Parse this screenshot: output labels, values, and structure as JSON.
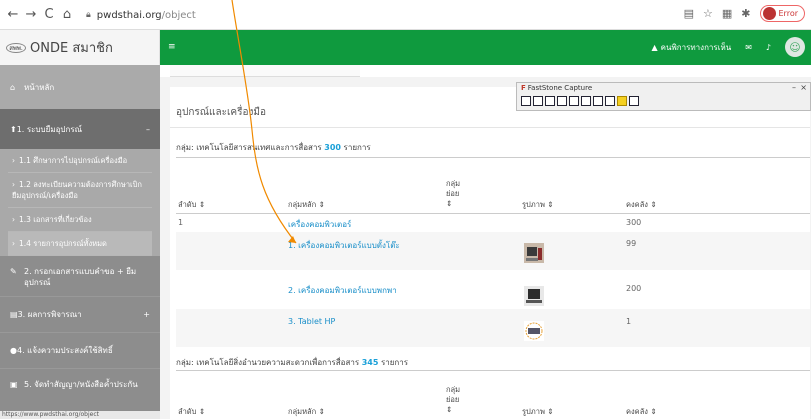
{
  "browser": {
    "url_domain": "pwdsthai.org",
    "url_path": "/object",
    "profile_label": "Error"
  },
  "brand": {
    "logo_text": "สพพ.",
    "title": "ONDE สมาชิก"
  },
  "header": {
    "menu_icon": "≡",
    "user_name": "คนพิการทางการเห็น"
  },
  "sidebar": {
    "home": "หน้าหลัก",
    "menu1": "1. ระบบยืมอุปกรณ์",
    "menu1_sub": [
      "1.1 ศึกษาการไปอุปกรณ์เครื่องมือ",
      "1.2 ลงทะเบียนความต้องการศึกษาเบิกยืมอุปกรณ์/เครื่องมือ",
      "1.3 เอกสารที่เกี่ยวข้อง",
      "1.4 รายการอุปกรณ์ทั้งหมด"
    ],
    "menu2": "2. กรอกเอกสารแบบคำขอ + ยืมอุปกรณ์",
    "menu3": "3. ผลการพิจารณา",
    "menu4": "4. แจ้งความประสงค์ใช้สิทธิ์",
    "menu5": "5. จัดทำสัญญา/หนังสือค้ำประกัน"
  },
  "status_bar_url": "https://www.pwdsthai.org/object",
  "content": {
    "page_title": "อุปกรณ์และเครื่องมือ",
    "group1": {
      "prefix": "กลุ่ม: เทคโนโลยีสารสนเทศและการสื่อสาร",
      "count": "300",
      "suffix": "รายการ"
    },
    "group2": {
      "prefix": "กลุ่ม: เทคโนโลยีสิ่งอำนวยความสะดวกเพื่อการสื่อสาร",
      "count": "345",
      "suffix": "รายการ"
    },
    "headers": {
      "order": "ลำดับ ⇕",
      "main_group": "กลุ่มหลัก ⇕",
      "sub_group_line1": "กลุ่ม",
      "sub_group_line2": "ย่อย",
      "sub_group_line3": "⇕",
      "image": "รูปภาพ ⇕",
      "remaining": "คงคลัง ⇕"
    },
    "rows": [
      {
        "order": "1",
        "name": "เครื่องคอมพิวเตอร์",
        "remaining": "300"
      },
      {
        "order": "",
        "name": "1. เครื่องคอมพิวเตอร์แบบตั้งโต๊ะ",
        "remaining": "99"
      },
      {
        "order": "",
        "name": "2. เครื่องคอมพิวเตอร์แบบพกพา",
        "remaining": "200"
      },
      {
        "order": "",
        "name": "3. Tablet HP",
        "remaining": "1"
      }
    ]
  },
  "fastcapture": {
    "title": "FastStone Capture"
  },
  "colors": {
    "header_green": "#0f9a3e",
    "link_blue": "#1a8fc9",
    "sidebar_gray": "#8d8d8d"
  }
}
